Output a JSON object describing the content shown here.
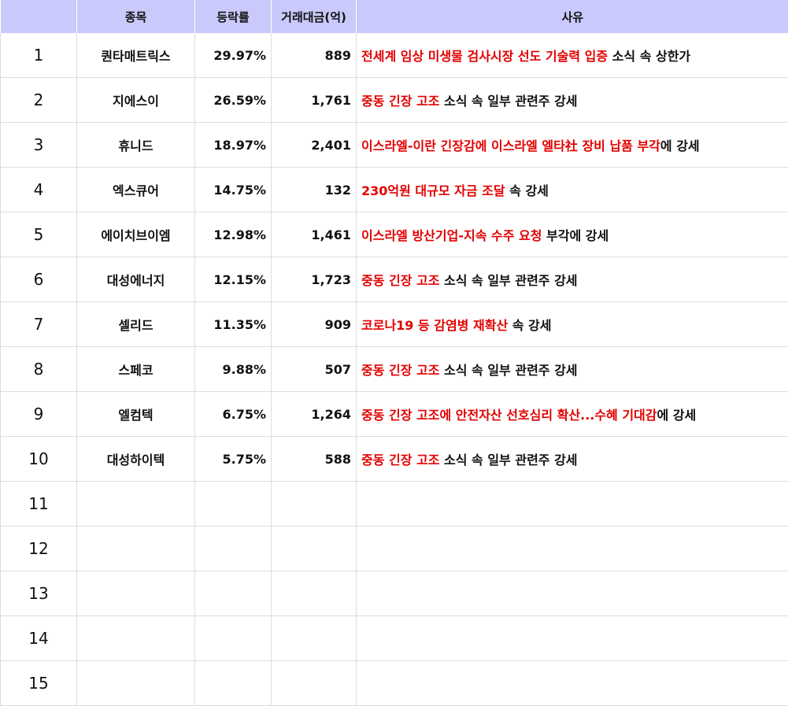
{
  "headers": {
    "rank": "",
    "stock": "종목",
    "change": "등락률",
    "volume": "거래대금(억)",
    "reason": "사유"
  },
  "colors": {
    "header_bg": "#c9c9fb",
    "highlight": "#e30000",
    "text": "#111111"
  },
  "rows": [
    {
      "rank": "1",
      "name": "퀀타매트릭스",
      "change": "29.97%",
      "volume": "889",
      "reason_hl": "전세계 임상 미생물 검사시장 선도 기술력 입증",
      "reason_rest": " 소식 속 상한가"
    },
    {
      "rank": "2",
      "name": "지에스이",
      "change": "26.59%",
      "volume": "1,761",
      "reason_hl": "중동 긴장 고조",
      "reason_rest": " 소식 속 일부 관련주 강세"
    },
    {
      "rank": "3",
      "name": "휴니드",
      "change": "18.97%",
      "volume": "2,401",
      "reason_hl": "이스라엘-이란 긴장감에 이스라엘 엘타社 장비 납품 부각",
      "reason_rest": "에 강세"
    },
    {
      "rank": "4",
      "name": "엑스큐어",
      "change": "14.75%",
      "volume": "132",
      "reason_hl": "230억원 대규모 자금 조달",
      "reason_rest": " 속 강세"
    },
    {
      "rank": "5",
      "name": "에이치브이엠",
      "change": "12.98%",
      "volume": "1,461",
      "reason_hl": "이스라엘 방산기업-지속 수주 요청",
      "reason_rest": " 부각에 강세"
    },
    {
      "rank": "6",
      "name": "대성에너지",
      "change": "12.15%",
      "volume": "1,723",
      "reason_hl": "중동 긴장 고조",
      "reason_rest": " 소식 속 일부 관련주 강세"
    },
    {
      "rank": "7",
      "name": "셀리드",
      "change": "11.35%",
      "volume": "909",
      "reason_hl": "코로나19 등 감염병 재확산",
      "reason_rest": " 속 강세"
    },
    {
      "rank": "8",
      "name": "스페코",
      "change": "9.88%",
      "volume": "507",
      "reason_hl": "중동 긴장 고조",
      "reason_rest": " 소식 속 일부 관련주 강세"
    },
    {
      "rank": "9",
      "name": "엘컴텍",
      "change": "6.75%",
      "volume": "1,264",
      "reason_hl": "중동 긴장 고조에 안전자산 선호심리 확산...수혜 기대감",
      "reason_rest": "에 강세"
    },
    {
      "rank": "10",
      "name": "대성하이텍",
      "change": "5.75%",
      "volume": "588",
      "reason_hl": "중동 긴장 고조",
      "reason_rest": " 소식 속 일부 관련주 강세"
    },
    {
      "rank": "11",
      "name": "",
      "change": "",
      "volume": "",
      "reason_hl": "",
      "reason_rest": ""
    },
    {
      "rank": "12",
      "name": "",
      "change": "",
      "volume": "",
      "reason_hl": "",
      "reason_rest": ""
    },
    {
      "rank": "13",
      "name": "",
      "change": "",
      "volume": "",
      "reason_hl": "",
      "reason_rest": ""
    },
    {
      "rank": "14",
      "name": "",
      "change": "",
      "volume": "",
      "reason_hl": "",
      "reason_rest": ""
    },
    {
      "rank": "15",
      "name": "",
      "change": "",
      "volume": "",
      "reason_hl": "",
      "reason_rest": ""
    }
  ]
}
